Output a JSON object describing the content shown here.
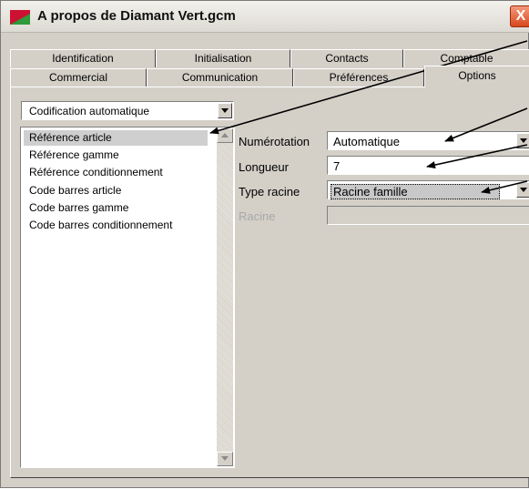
{
  "window": {
    "title": "A propos de Diamant Vert.gcm",
    "close_label": "X"
  },
  "tabs_row1": [
    "Identification",
    "Initialisation",
    "Contacts",
    "Comptable"
  ],
  "tabs_row2": [
    "Commercial",
    "Communication",
    "Préférences",
    "Options"
  ],
  "active_tab": "Options",
  "category_select": {
    "value": "Codification automatique"
  },
  "list": {
    "items": [
      "Référence article",
      "Référence gamme",
      "Référence conditionnement",
      "Code barres article",
      "Code barres gamme",
      "Code barres conditionnement"
    ],
    "selected": "Référence article"
  },
  "form": {
    "numerotation_label": "Numérotation",
    "numerotation_value": "Automatique",
    "longueur_label": "Longueur",
    "longueur_value": "7",
    "type_racine_label": "Type racine",
    "type_racine_value": "Racine famille",
    "racine_label": "Racine",
    "racine_value": ""
  },
  "icons": [
    "app-icon",
    "close-icon",
    "dropdown-arrow-icon",
    "scroll-up-arrow-icon",
    "scroll-down-arrow-icon"
  ]
}
